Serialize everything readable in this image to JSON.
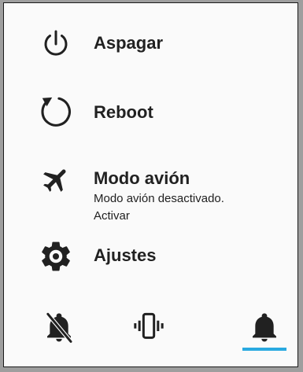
{
  "menu": {
    "items": [
      {
        "label": "Aspagar",
        "icon": "power-icon"
      },
      {
        "label": "Reboot",
        "icon": "reboot-icon"
      },
      {
        "label": "Modo avión",
        "sub_line1": "Modo avión desactivado.",
        "sub_line2": "Activar",
        "icon": "airplane-icon"
      },
      {
        "label": "Ajustes",
        "icon": "gear-icon"
      }
    ]
  },
  "sound_modes": {
    "options": [
      {
        "icon": "bell-off-icon",
        "selected": false
      },
      {
        "icon": "vibrate-icon",
        "selected": false
      },
      {
        "icon": "bell-icon",
        "selected": true
      }
    ],
    "accent_color": "#29a9e0"
  },
  "colors": {
    "text": "#212121",
    "background": "#fafafa",
    "backdrop": "#9e9e9e"
  }
}
